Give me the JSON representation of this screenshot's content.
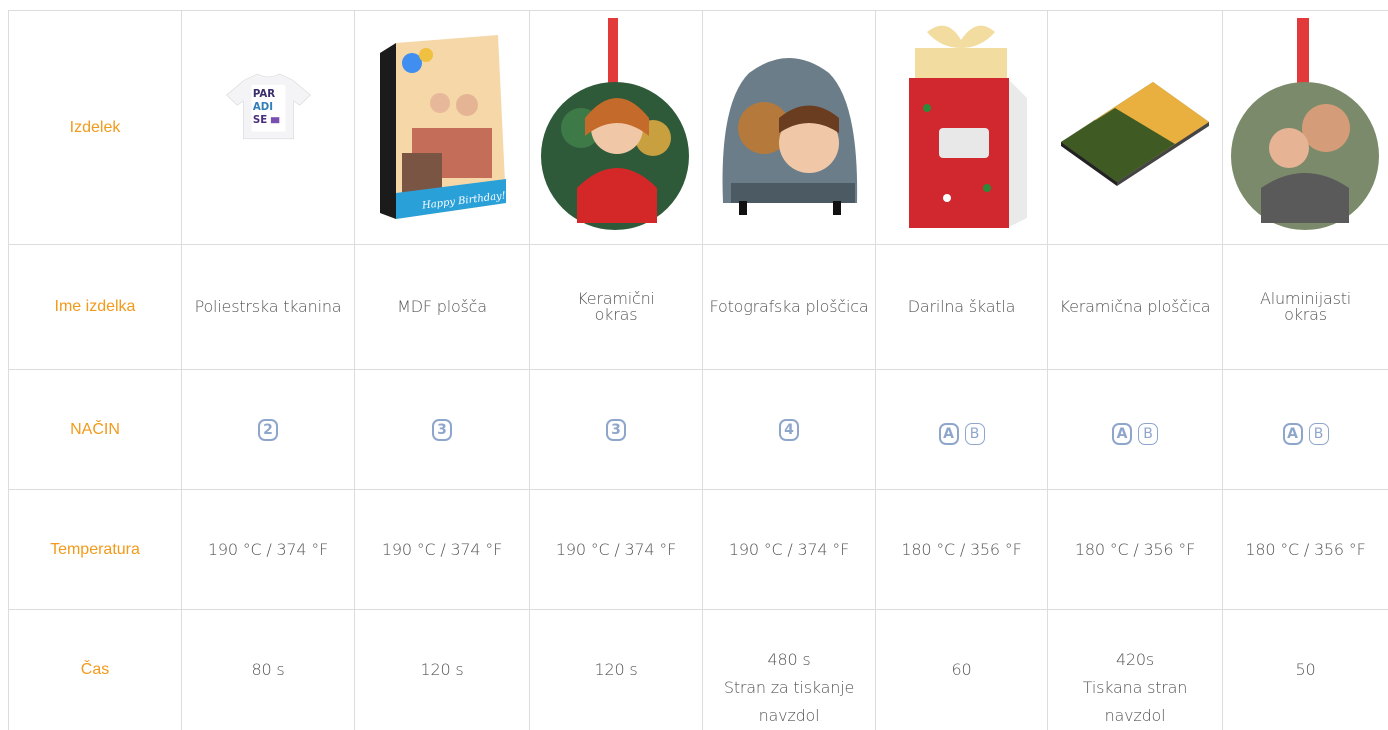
{
  "rows": {
    "product_label": "Izdelek",
    "name_label": "Ime izdelka",
    "method_label": "NAČIN",
    "temp_label": "Temperatura",
    "time_label": "Čas"
  },
  "products": [
    {
      "name": "Poliestrska tkanina",
      "image": "tshirt-image",
      "shirt_text": [
        "PAR",
        "ADI",
        "SE"
      ],
      "methods": [
        "2"
      ],
      "temperature": "190 °C / 374 °F",
      "time": [
        "80 s"
      ]
    },
    {
      "name": "MDF plošča",
      "image": "mdf-board-image",
      "banner_text": "Happy Birthday!",
      "methods": [
        "3"
      ],
      "temperature": "190 °C / 374 °F",
      "time": [
        "120 s"
      ]
    },
    {
      "name_lines": [
        "Keramični",
        "okras"
      ],
      "image": "ceramic-ornament-image",
      "methods": [
        "3"
      ],
      "temperature": "190 °C / 374 °F",
      "time": [
        "120 s"
      ]
    },
    {
      "name": "Fotografska ploščica",
      "image": "photo-slate-image",
      "methods": [
        "4"
      ],
      "temperature": "190 °C / 374 °F",
      "time": [
        "480 s",
        "Stran za tiskanje",
        "navzdol"
      ]
    },
    {
      "name": "Darilna škatla",
      "image": "gift-box-image",
      "methods": [
        "A",
        "B"
      ],
      "temperature": "180 °C / 356 °F",
      "time": [
        "60"
      ]
    },
    {
      "name": "Keramična ploščica",
      "image": "ceramic-tile-image",
      "methods": [
        "A",
        "B"
      ],
      "temperature": "180 °C / 356 °F",
      "time": [
        "420s",
        "Tiskana stran",
        "navzdol"
      ]
    },
    {
      "name_lines": [
        "Aluminijasti",
        "okras"
      ],
      "image": "aluminum-ornament-image",
      "methods": [
        "A",
        "B"
      ],
      "temperature": "180 °C / 356 °F",
      "time": [
        "50"
      ]
    }
  ],
  "colors": {
    "header_text": "#f29a1a",
    "body_text": "#555555",
    "badge": "#8fa6cc",
    "grid_line": "#dcdcdc"
  }
}
